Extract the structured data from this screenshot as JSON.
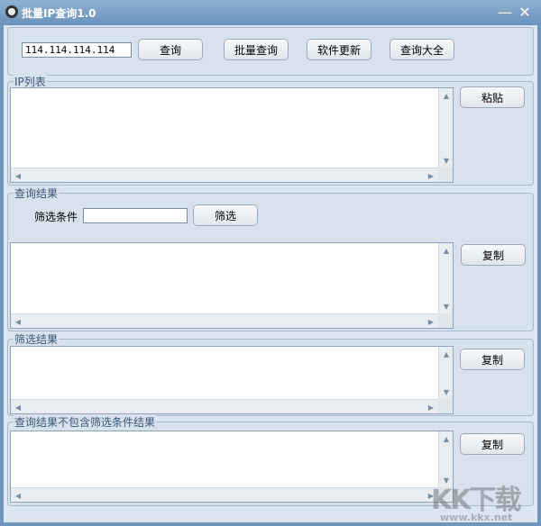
{
  "window": {
    "title": "批量IP查询1.0",
    "minimize": "—",
    "close": "✕"
  },
  "toolbar": {
    "ip_value": "114.114.114.114",
    "query": "查询",
    "batch_query": "批量查询",
    "update": "软件更新",
    "query_all": "查询大全"
  },
  "ip_list": {
    "label": "IP列表",
    "paste": "粘贴"
  },
  "results": {
    "label": "查询结果",
    "filter_label": "筛选条件",
    "filter_value": "",
    "filter_button": "筛选",
    "copy": "复制"
  },
  "filtered": {
    "label": "筛选结果",
    "copy": "复制"
  },
  "excluded": {
    "label": "查询结果不包含筛选条件结果",
    "copy": "复制"
  },
  "watermark": {
    "logo": "KK下载",
    "url": "www.kkx.net"
  }
}
